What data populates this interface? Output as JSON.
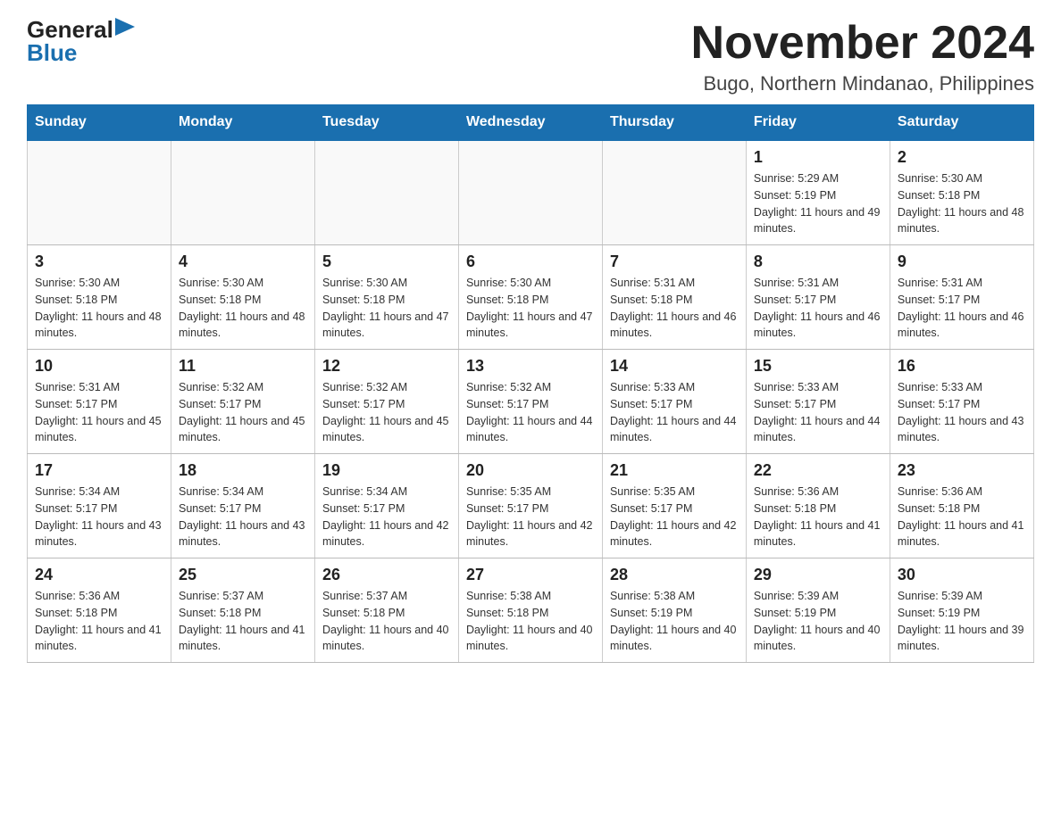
{
  "logo": {
    "general": "General",
    "blue": "Blue"
  },
  "header": {
    "title": "November 2024",
    "subtitle": "Bugo, Northern Mindanao, Philippines"
  },
  "days_of_week": [
    "Sunday",
    "Monday",
    "Tuesday",
    "Wednesday",
    "Thursday",
    "Friday",
    "Saturday"
  ],
  "weeks": [
    [
      {
        "day": "",
        "info": ""
      },
      {
        "day": "",
        "info": ""
      },
      {
        "day": "",
        "info": ""
      },
      {
        "day": "",
        "info": ""
      },
      {
        "day": "",
        "info": ""
      },
      {
        "day": "1",
        "info": "Sunrise: 5:29 AM\nSunset: 5:19 PM\nDaylight: 11 hours and 49 minutes."
      },
      {
        "day": "2",
        "info": "Sunrise: 5:30 AM\nSunset: 5:18 PM\nDaylight: 11 hours and 48 minutes."
      }
    ],
    [
      {
        "day": "3",
        "info": "Sunrise: 5:30 AM\nSunset: 5:18 PM\nDaylight: 11 hours and 48 minutes."
      },
      {
        "day": "4",
        "info": "Sunrise: 5:30 AM\nSunset: 5:18 PM\nDaylight: 11 hours and 48 minutes."
      },
      {
        "day": "5",
        "info": "Sunrise: 5:30 AM\nSunset: 5:18 PM\nDaylight: 11 hours and 47 minutes."
      },
      {
        "day": "6",
        "info": "Sunrise: 5:30 AM\nSunset: 5:18 PM\nDaylight: 11 hours and 47 minutes."
      },
      {
        "day": "7",
        "info": "Sunrise: 5:31 AM\nSunset: 5:18 PM\nDaylight: 11 hours and 46 minutes."
      },
      {
        "day": "8",
        "info": "Sunrise: 5:31 AM\nSunset: 5:17 PM\nDaylight: 11 hours and 46 minutes."
      },
      {
        "day": "9",
        "info": "Sunrise: 5:31 AM\nSunset: 5:17 PM\nDaylight: 11 hours and 46 minutes."
      }
    ],
    [
      {
        "day": "10",
        "info": "Sunrise: 5:31 AM\nSunset: 5:17 PM\nDaylight: 11 hours and 45 minutes."
      },
      {
        "day": "11",
        "info": "Sunrise: 5:32 AM\nSunset: 5:17 PM\nDaylight: 11 hours and 45 minutes."
      },
      {
        "day": "12",
        "info": "Sunrise: 5:32 AM\nSunset: 5:17 PM\nDaylight: 11 hours and 45 minutes."
      },
      {
        "day": "13",
        "info": "Sunrise: 5:32 AM\nSunset: 5:17 PM\nDaylight: 11 hours and 44 minutes."
      },
      {
        "day": "14",
        "info": "Sunrise: 5:33 AM\nSunset: 5:17 PM\nDaylight: 11 hours and 44 minutes."
      },
      {
        "day": "15",
        "info": "Sunrise: 5:33 AM\nSunset: 5:17 PM\nDaylight: 11 hours and 44 minutes."
      },
      {
        "day": "16",
        "info": "Sunrise: 5:33 AM\nSunset: 5:17 PM\nDaylight: 11 hours and 43 minutes."
      }
    ],
    [
      {
        "day": "17",
        "info": "Sunrise: 5:34 AM\nSunset: 5:17 PM\nDaylight: 11 hours and 43 minutes."
      },
      {
        "day": "18",
        "info": "Sunrise: 5:34 AM\nSunset: 5:17 PM\nDaylight: 11 hours and 43 minutes."
      },
      {
        "day": "19",
        "info": "Sunrise: 5:34 AM\nSunset: 5:17 PM\nDaylight: 11 hours and 42 minutes."
      },
      {
        "day": "20",
        "info": "Sunrise: 5:35 AM\nSunset: 5:17 PM\nDaylight: 11 hours and 42 minutes."
      },
      {
        "day": "21",
        "info": "Sunrise: 5:35 AM\nSunset: 5:17 PM\nDaylight: 11 hours and 42 minutes."
      },
      {
        "day": "22",
        "info": "Sunrise: 5:36 AM\nSunset: 5:18 PM\nDaylight: 11 hours and 41 minutes."
      },
      {
        "day": "23",
        "info": "Sunrise: 5:36 AM\nSunset: 5:18 PM\nDaylight: 11 hours and 41 minutes."
      }
    ],
    [
      {
        "day": "24",
        "info": "Sunrise: 5:36 AM\nSunset: 5:18 PM\nDaylight: 11 hours and 41 minutes."
      },
      {
        "day": "25",
        "info": "Sunrise: 5:37 AM\nSunset: 5:18 PM\nDaylight: 11 hours and 41 minutes."
      },
      {
        "day": "26",
        "info": "Sunrise: 5:37 AM\nSunset: 5:18 PM\nDaylight: 11 hours and 40 minutes."
      },
      {
        "day": "27",
        "info": "Sunrise: 5:38 AM\nSunset: 5:18 PM\nDaylight: 11 hours and 40 minutes."
      },
      {
        "day": "28",
        "info": "Sunrise: 5:38 AM\nSunset: 5:19 PM\nDaylight: 11 hours and 40 minutes."
      },
      {
        "day": "29",
        "info": "Sunrise: 5:39 AM\nSunset: 5:19 PM\nDaylight: 11 hours and 40 minutes."
      },
      {
        "day": "30",
        "info": "Sunrise: 5:39 AM\nSunset: 5:19 PM\nDaylight: 11 hours and 39 minutes."
      }
    ]
  ]
}
